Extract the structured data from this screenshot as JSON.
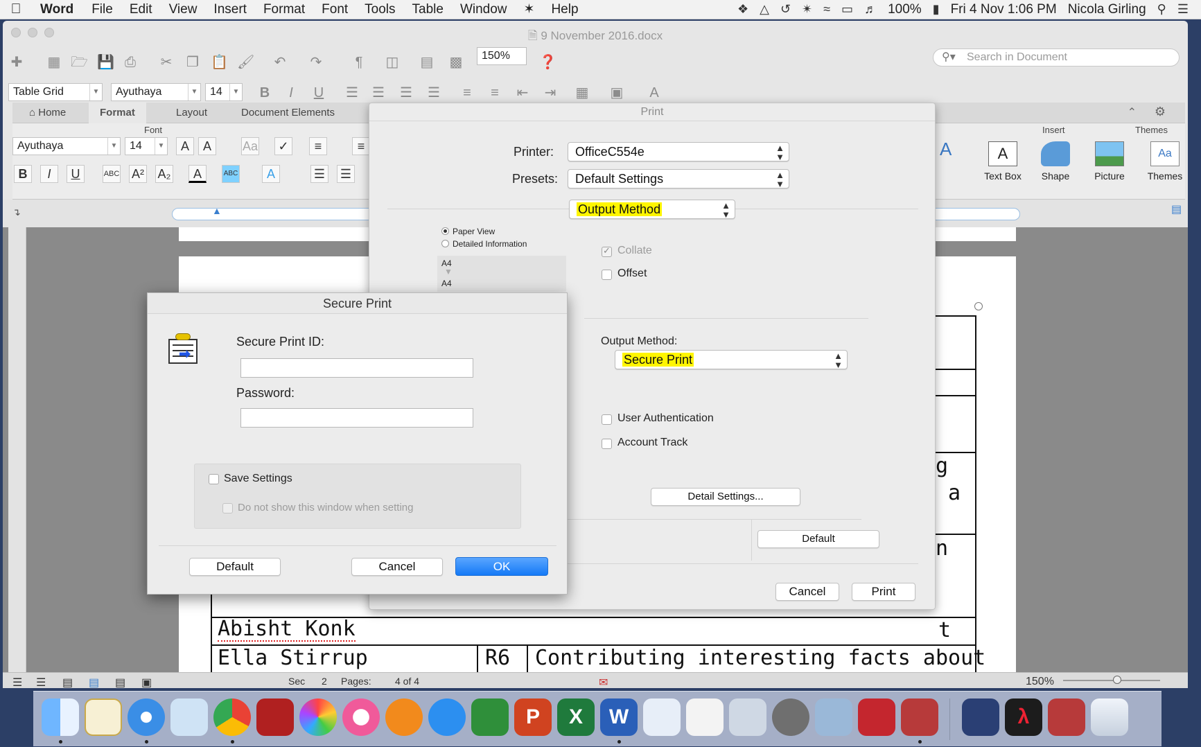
{
  "menubar": {
    "app_name": "Word",
    "items": [
      "File",
      "Edit",
      "View",
      "Insert",
      "Format",
      "Font",
      "Tools",
      "Table",
      "Window",
      "Help"
    ],
    "battery": "100%",
    "clock": "Fri 4 Nov  1:06 PM",
    "user": "Nicola Girling"
  },
  "window": {
    "title": "9 November 2016.docx",
    "zoom": "150%",
    "search_placeholder": "Search in Document"
  },
  "format_toolbar": {
    "style": "Table Grid",
    "font": "Ayuthaya",
    "size": "14"
  },
  "ribbon": {
    "tabs": [
      "Home",
      "Format",
      "Layout",
      "Document Elements"
    ],
    "active_tab": "Format",
    "font_group_label": "Font",
    "font": "Ayuthaya",
    "size": "14",
    "insert_group_label": "Insert",
    "themes_group_label": "Themes",
    "insert_buttons": [
      "Text Box",
      "Shape",
      "Picture"
    ],
    "themes_button": "Themes"
  },
  "document": {
    "rows": [
      {
        "name": "Abisht Konk",
        "code": "",
        "text": "t"
      },
      {
        "name": "Ella Stirrup",
        "code": "R6",
        "text": "Contributing interesting facts about"
      }
    ],
    "right_fragments": [
      "g",
      "a",
      "n"
    ]
  },
  "statusbar": {
    "sec_label": "Sec",
    "sec_value": "2",
    "pages_label": "Pages:",
    "pages_value": "4 of 4",
    "zoom": "150%"
  },
  "print_dialog": {
    "title": "Print",
    "printer_label": "Printer:",
    "printer_value": "OfficeC554e",
    "presets_label": "Presets:",
    "presets_value": "Default Settings",
    "pane_value": "Output Method",
    "view_options": [
      "Paper View",
      "Detailed Information"
    ],
    "paper_labels": [
      "A4",
      "A4"
    ],
    "collate_label": "Collate",
    "offset_label": "Offset",
    "output_method_label": "Output Method:",
    "output_method_value": "Secure Print",
    "user_auth_label": "User Authentication",
    "account_track_label": "Account Track",
    "detail_settings_label": "Detail Settings...",
    "default_label": "Default",
    "cancel_label": "Cancel",
    "print_label": "Print"
  },
  "secure_print": {
    "title": "Secure Print",
    "id_label": "Secure Print ID:",
    "id_value": "",
    "password_label": "Password:",
    "password_value": "",
    "save_settings_label": "Save Settings",
    "dont_show_label": "Do not show this window when setting",
    "default_label": "Default",
    "cancel_label": "Cancel",
    "ok_label": "OK"
  },
  "colors": {
    "highlight": "#fff500",
    "ok_button": "#1479f6"
  }
}
